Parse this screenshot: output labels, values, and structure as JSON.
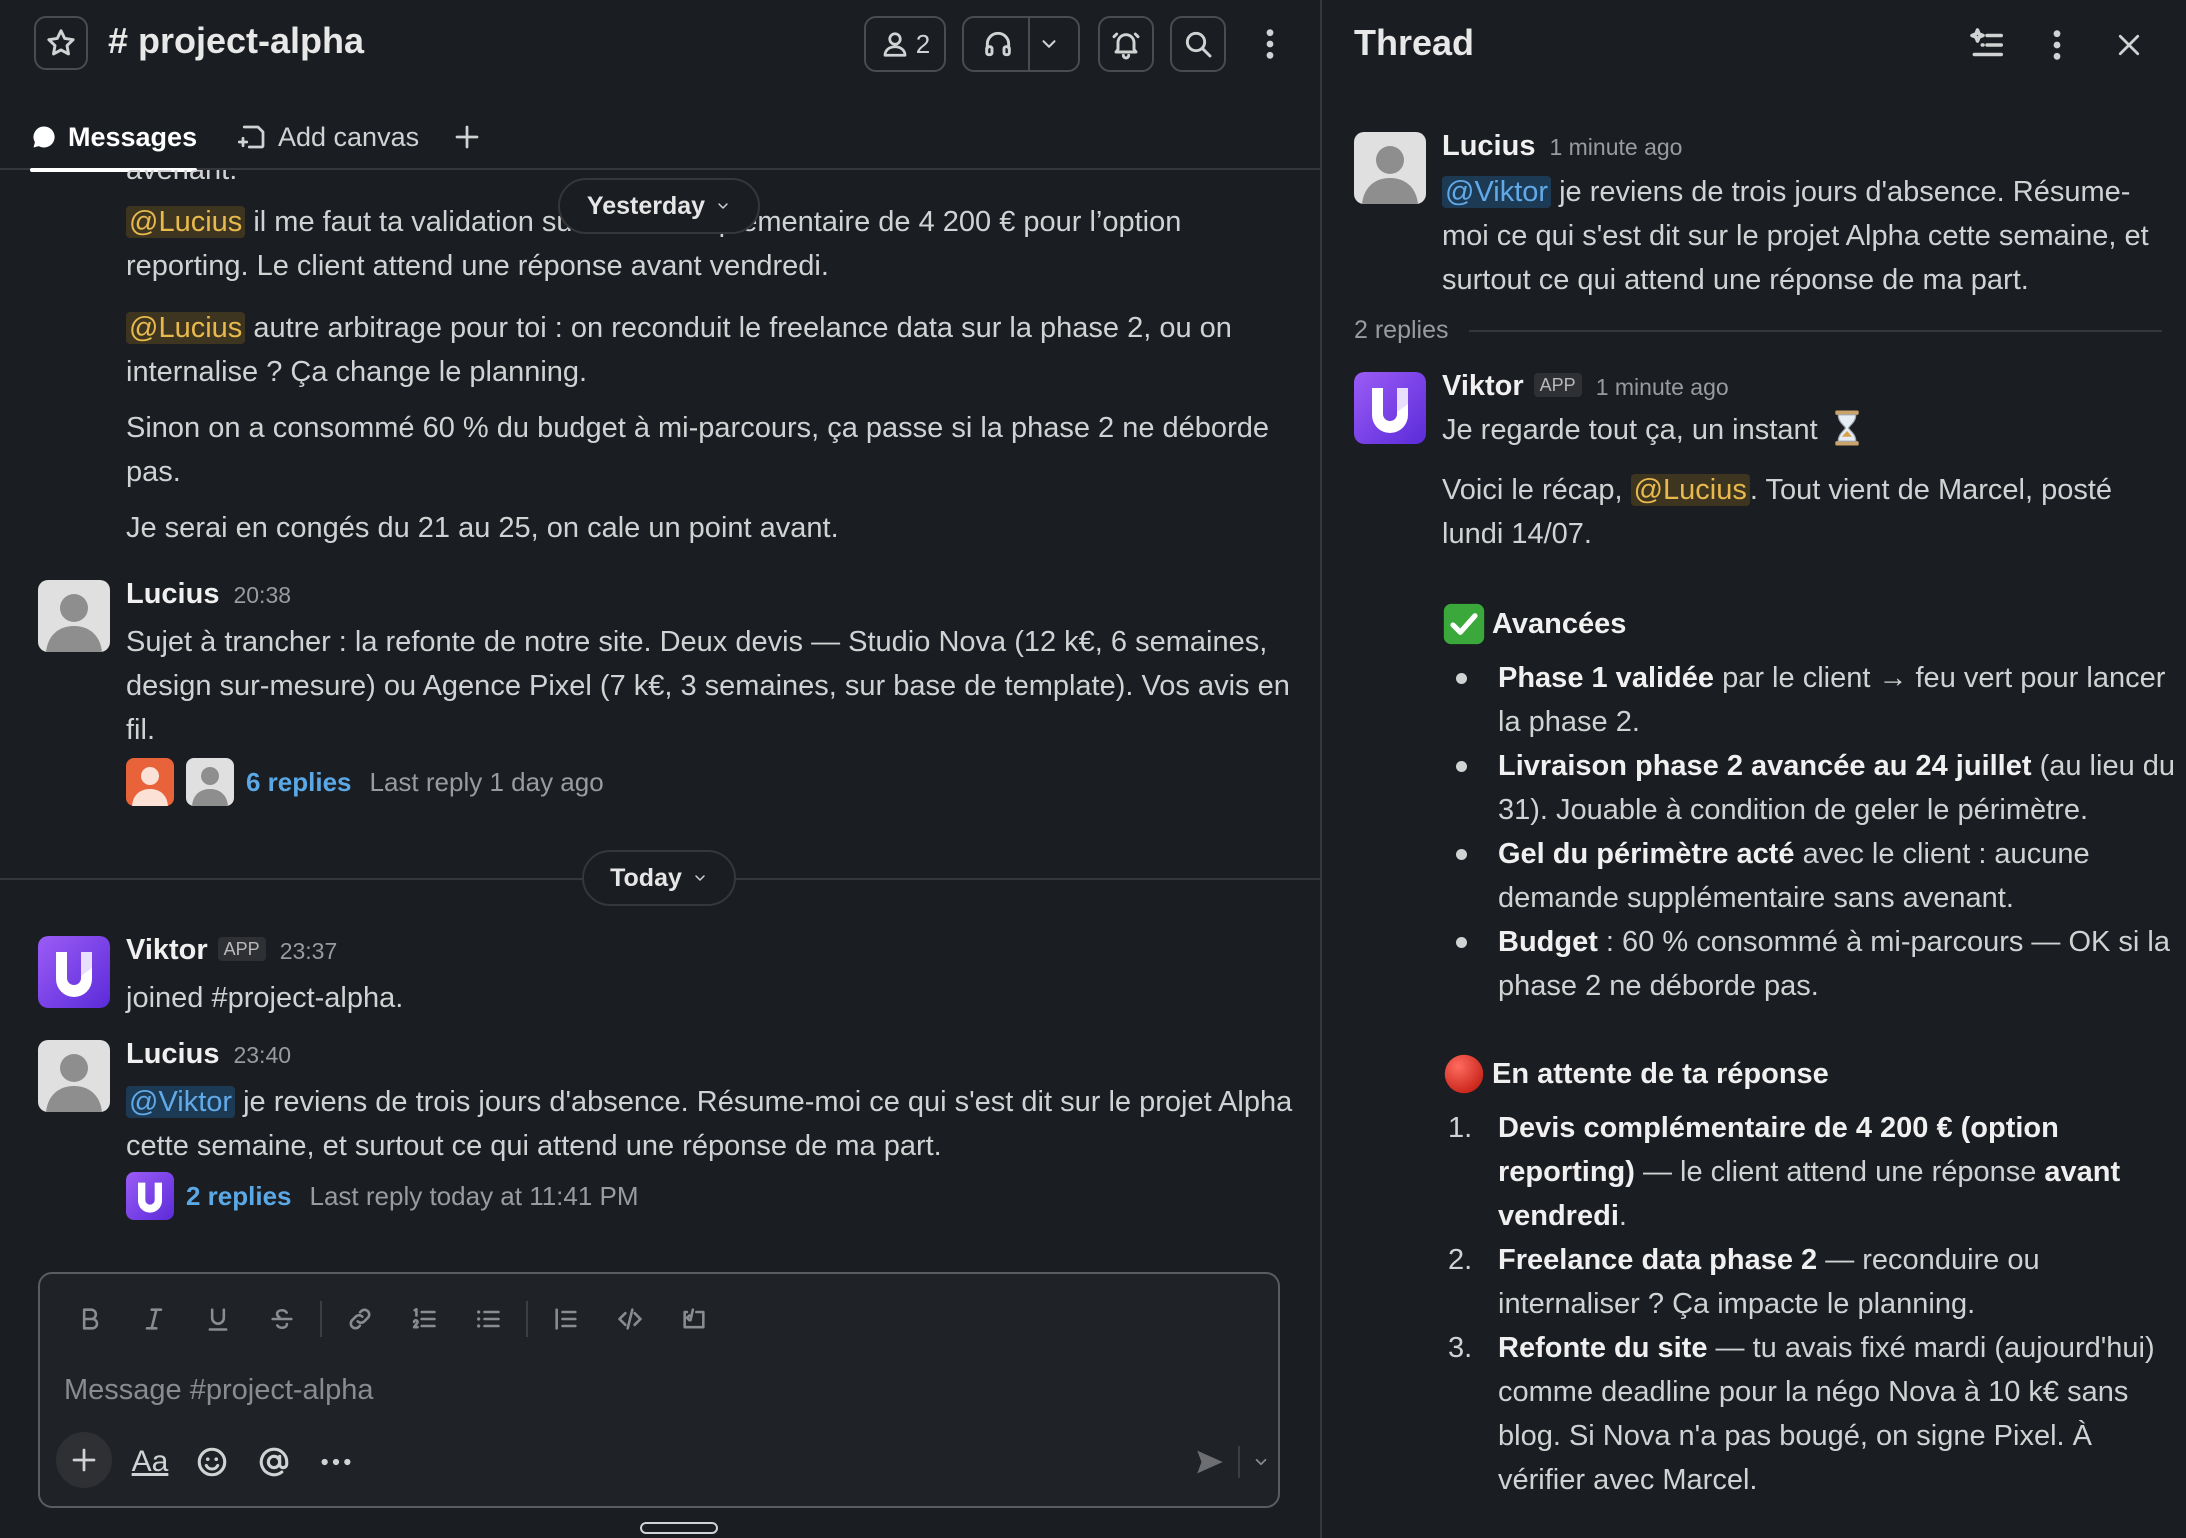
{
  "channel": {
    "title": "# project-alpha",
    "member_count": "2",
    "tabs": {
      "messages": "Messages",
      "add_canvas": "Add canvas"
    },
    "day_pills": {
      "yesterday": "Yesterday",
      "today": "Today"
    },
    "partial_top": "avenant.",
    "marcel_lines": {
      "l1_pre": "il me faut ta validation su",
      "l1_post": "mplémentaire de 4 200 € pour l’option",
      "l1_rest": "reporting. Le client attend une réponse avant vendredi.",
      "l2": "autre arbitrage pour toi : on reconduit le freelance data sur la phase 2, ou on internalise ? Ça change le planning.",
      "l3": "Sinon on a consommé 60 % du budget à mi-parcours, ça passe si la phase 2 ne déborde pas.",
      "l4": "Je serai en congés du 21 au 25, on cale un point avant."
    },
    "mention_lucius": "@Lucius",
    "mention_viktor": "@Viktor",
    "msg_lucius_1": {
      "name": "Lucius",
      "time": "20:38",
      "text": "Sujet à trancher : la refonte de notre site. Deux devis — Studio Nova (12 k€, 6 semaines, design sur-mesure) ou Agence Pixel (7 k€, 3 semaines, sur base de template). Vos avis en fil.",
      "replies": "6 replies",
      "last_reply": "Last reply 1 day ago"
    },
    "msg_viktor_join": {
      "name": "Viktor",
      "badge": "APP",
      "time": "23:37",
      "text": "joined #project-alpha."
    },
    "msg_lucius_2": {
      "name": "Lucius",
      "time": "23:40",
      "text": "je reviens de trois jours d'absence. Résume-moi ce qui s'est dit sur le projet Alpha cette semaine, et surtout ce qui attend une réponse de ma part.",
      "replies": "2 replies",
      "last_reply": "Last reply today at 11:41 PM"
    },
    "composer_placeholder": "Message #project-alpha",
    "composer_aa": "Aa"
  },
  "thread": {
    "title": "Thread",
    "parent": {
      "name": "Lucius",
      "time": "1 minute ago",
      "mention": "@Viktor",
      "text": "je reviens de trois jours d'absence. Résume-moi ce qui s'est dit sur le projet Alpha cette semaine, et surtout ce qui attend une réponse de ma part."
    },
    "reply_count": "2 replies",
    "reply": {
      "name": "Viktor",
      "badge": "APP",
      "time": "1 minute ago",
      "line1": "Je regarde tout ça, un instant",
      "recap_pre": "Voici le récap,",
      "recap_mention": "@Lucius",
      "recap_post": ". Tout vient de Marcel, posté lundi 14/07.",
      "advances_title": "Avancées",
      "advances": [
        {
          "bold": "Phase 1 validée",
          "rest": " par le client → feu vert pour lancer la phase 2."
        },
        {
          "bold": "Livraison phase 2 avancée au 24 juillet",
          "rest": " (au lieu du 31). Jouable à condition de geler le périmètre."
        },
        {
          "bold": "Gel du périmètre acté",
          "rest": " avec le client : aucune demande supplémentaire sans avenant."
        },
        {
          "bold": "Budget",
          "rest": " : 60 % consommé à mi-parcours — OK si la phase 2 ne déborde pas."
        }
      ],
      "pending_title": "En attente de ta réponse",
      "pending": [
        {
          "num": "1.",
          "bold": "Devis complémentaire de 4 200 € (option reporting)",
          "rest": " — le client attend une réponse ",
          "bold2": "avant vendredi",
          "tail": "."
        },
        {
          "num": "2.",
          "bold": "Freelance data phase 2",
          "rest": " — reconduire ou internaliser ? Ça impacte le planning.",
          "bold2": "",
          "tail": ""
        },
        {
          "num": "3.",
          "bold": "Refonte du site",
          "rest": " — tu avais fixé mardi (aujourd'hui) comme deadline pour la négo Nova à 10 k€ sans blog. Si Nova n'a pas bougé, on signe Pixel. À vérifier avec Marcel.",
          "bold2": "",
          "tail": ""
        }
      ]
    }
  },
  "colors": {
    "background": "#1a1d21",
    "mention_bg": "#3d3520",
    "mention_fg": "#e8b94c",
    "link": "#5aa8e6",
    "app_purple": "#7b3fe4"
  }
}
